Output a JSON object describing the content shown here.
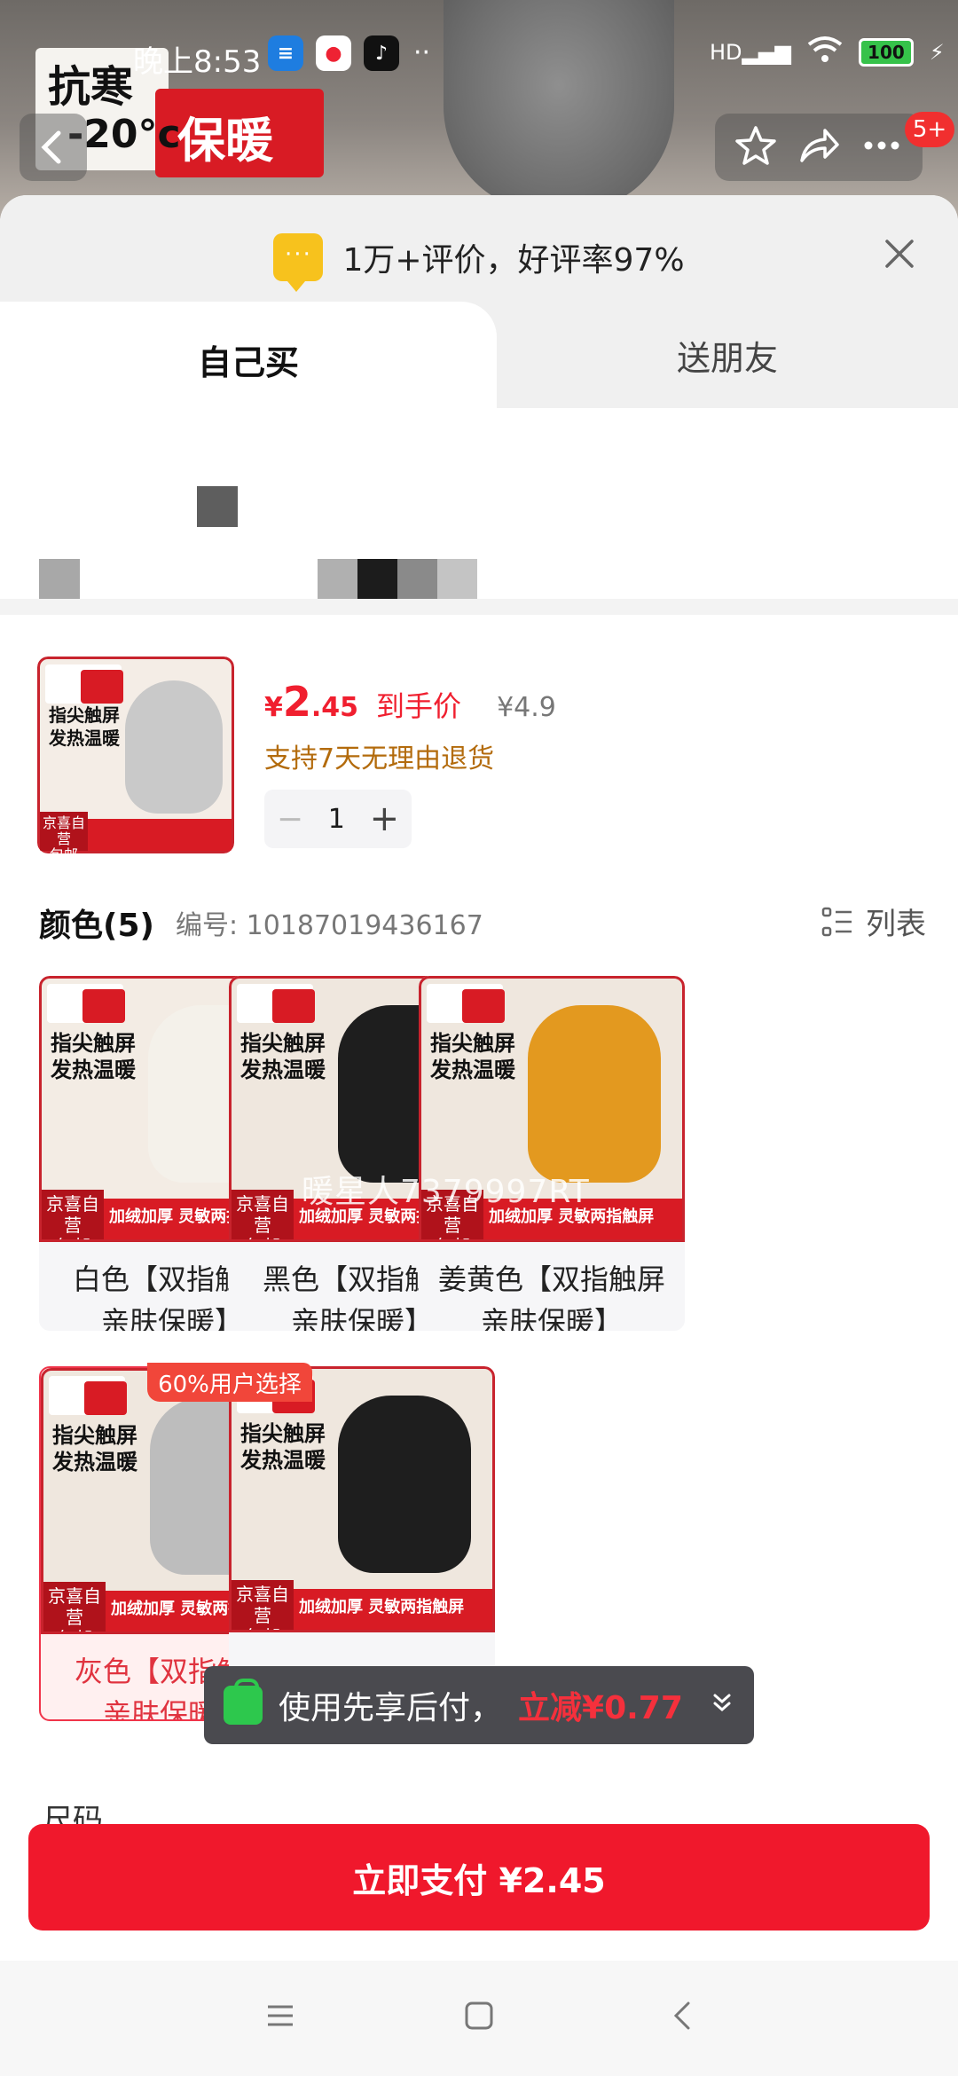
{
  "status_bar": {
    "time": "晚上8:53",
    "battery": "100",
    "network": "HD",
    "more_dots": "··"
  },
  "header_image": {
    "badge_line1": "抗寒",
    "badge_line2": "-20°c",
    "badge_red": "保暖"
  },
  "nav": {
    "notification_badge": "5+"
  },
  "review_banner": {
    "text": "1万+评价，好评率97%"
  },
  "tabs": [
    {
      "label": "自己买",
      "active": true
    },
    {
      "label": "送朋友",
      "active": false
    }
  ],
  "product": {
    "price_yen": "¥",
    "price_int": "2",
    "price_dec": ".45",
    "price_tag": "到手价",
    "original_price": "¥4.9",
    "return_policy": "支持7天无理由退货",
    "quantity": "1",
    "qty_minus": "−",
    "qty_plus": "+"
  },
  "colors": {
    "title": "颜色(5)",
    "code": "编号: 10187019436167",
    "list_label": "列表",
    "watermark": "暖星人7379997RT",
    "popular_badge": "60%用户选择",
    "image_text": {
      "badge_top": "抗寒",
      "badge_red": "保暖",
      "slogan_1": "指尖触屏",
      "slogan_2": "发热温暖",
      "foot_tag_1": "京喜自营",
      "foot_tag_2": "包邮",
      "foot_text": "加绒加厚 灵敏两指触屏"
    },
    "options": [
      {
        "label": "白色【双指触屏亲肤保暖】",
        "line1": "白色【双指触屏",
        "line2": "亲肤保暖】",
        "glove": "#f2efe8"
      },
      {
        "label": "黑色【双指触屏亲肤保暖】",
        "line1": "黑色【双指触屏",
        "line2": "亲肤保暖】",
        "glove": "#1e1e1e"
      },
      {
        "label": "姜黄色【双指触屏亲肤保暖】",
        "line1": "姜黄色【双指触屏",
        "line2": "亲肤保暖】",
        "glove": "#e3991f"
      },
      {
        "label": "灰色【双指触屏亲肤保暖】",
        "line1": "灰色【双指触屏",
        "line2": "亲肤保暖】",
        "glove": "#bdbdbd",
        "selected": true
      },
      {
        "label": "",
        "line1": "",
        "line2": "",
        "glove": "#1e1e1e"
      }
    ]
  },
  "toast": {
    "text": "使用先享后付，",
    "highlight": "立减¥0.77"
  },
  "section_peek": "尺码",
  "pay_button": {
    "label": "立即支付 ¥2.45"
  },
  "accent_color": "#f0182c"
}
